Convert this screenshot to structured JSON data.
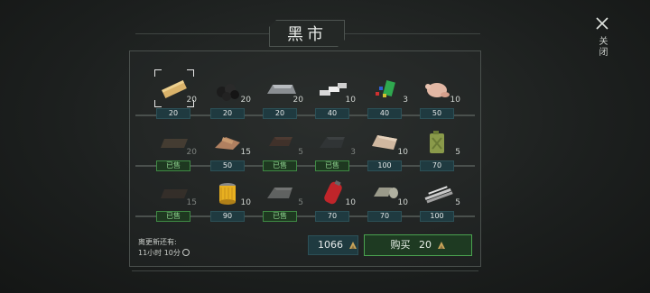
{
  "header": {
    "title": "黑市"
  },
  "close": {
    "label": "关闭"
  },
  "rows": [
    [
      {
        "icon": "wooden-plank",
        "qty": "20",
        "price": "20",
        "sold": false,
        "selected": true
      },
      {
        "icon": "coal",
        "qty": "20",
        "price": "20",
        "sold": false
      },
      {
        "icon": "iron-ingot",
        "qty": "20",
        "price": "20",
        "sold": false
      },
      {
        "icon": "steel-bars",
        "qty": "10",
        "price": "40",
        "sold": false
      },
      {
        "icon": "chemicals",
        "qty": "3",
        "price": "40",
        "sold": false
      },
      {
        "icon": "raw-chicken",
        "qty": "10",
        "price": "50",
        "sold": false
      }
    ],
    [
      {
        "icon": "leather",
        "qty": "20",
        "sold": true
      },
      {
        "icon": "scrap-wood-pile",
        "qty": "15",
        "price": "50",
        "sold": false
      },
      {
        "icon": "brown-leather",
        "qty": "5",
        "sold": true
      },
      {
        "icon": "dark-ingot",
        "qty": "3",
        "sold": true
      },
      {
        "icon": "cloth-bundle",
        "qty": "10",
        "price": "100",
        "sold": false
      },
      {
        "icon": "jerrycan",
        "qty": "5",
        "price": "70",
        "sold": false
      }
    ],
    [
      {
        "icon": "dark-board",
        "qty": "15",
        "sold": true
      },
      {
        "icon": "oil-filter",
        "qty": "10",
        "price": "90",
        "sold": false
      },
      {
        "icon": "silver-ingot",
        "qty": "5",
        "sold": true
      },
      {
        "icon": "red-gas-canister",
        "qty": "10",
        "price": "70",
        "sold": false
      },
      {
        "icon": "rolled-fabric",
        "qty": "10",
        "price": "70",
        "sold": false
      },
      {
        "icon": "metal-pipes",
        "qty": "5",
        "price": "100",
        "sold": false
      }
    ]
  ],
  "sold_label": "已售",
  "refresh": {
    "label": "离更新还有:",
    "time": "11小时 10分"
  },
  "wallet": {
    "amount": "1066",
    "coin_icon": "bullet-coin-icon"
  },
  "buy": {
    "label": "购买",
    "amount": "20"
  },
  "colors": {
    "price_bg": "#1f3a40",
    "sold_border": "#3f8a44",
    "buy_border": "#4aa24f"
  }
}
